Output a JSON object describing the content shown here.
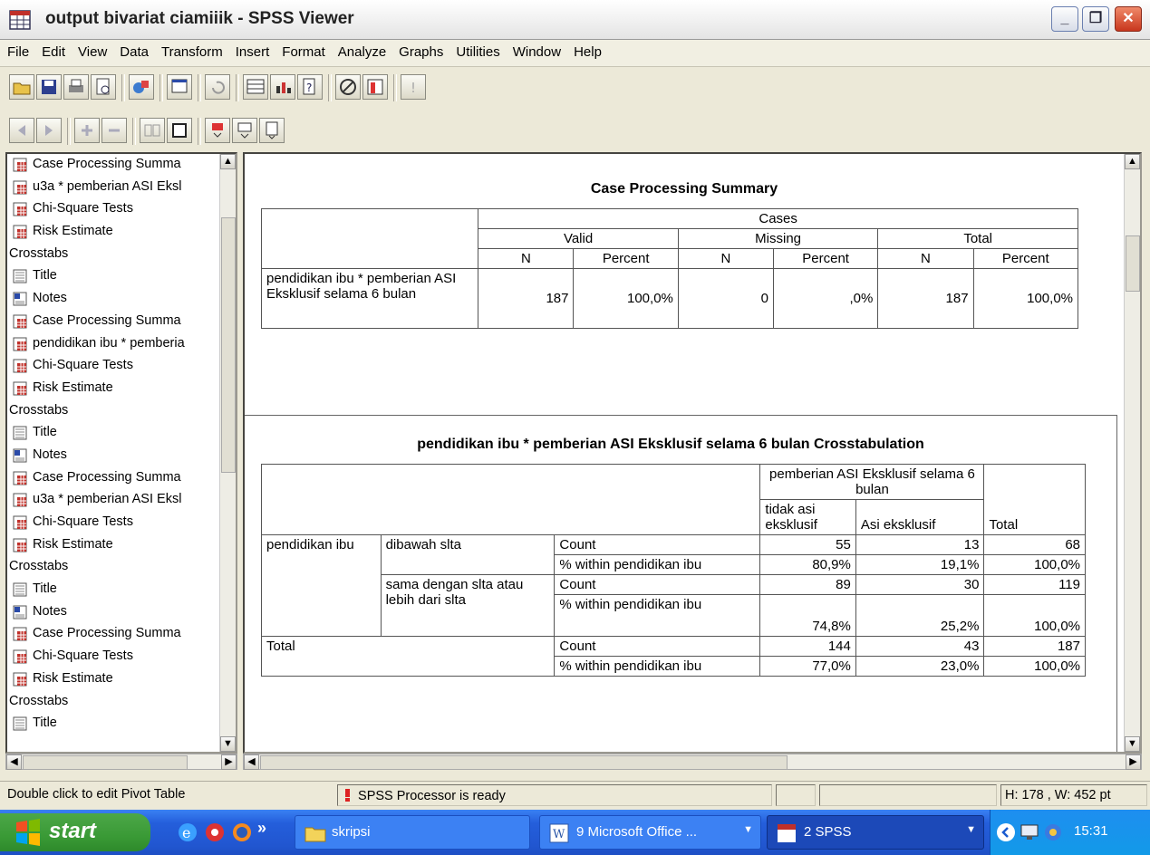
{
  "window": {
    "title": "output bivariat ciamiiik - SPSS Viewer",
    "min_label": "_",
    "max_label": "❐",
    "close_label": "✕"
  },
  "menu": [
    "File",
    "Edit",
    "View",
    "Data",
    "Transform",
    "Insert",
    "Format",
    "Analyze",
    "Graphs",
    "Utilities",
    "Window",
    "Help"
  ],
  "tree": [
    {
      "label": "Case Processing Summa",
      "icon": "table-icon",
      "hdr": false
    },
    {
      "label": "u3a * pemberian ASI Eksl",
      "icon": "table-icon",
      "hdr": false
    },
    {
      "label": "Chi-Square Tests",
      "icon": "table-icon",
      "hdr": false
    },
    {
      "label": "Risk Estimate",
      "icon": "table-icon",
      "hdr": false
    },
    {
      "label": "Crosstabs",
      "icon": "",
      "hdr": true
    },
    {
      "label": "Title",
      "icon": "title-icon",
      "hdr": false
    },
    {
      "label": "Notes",
      "icon": "notes-icon",
      "hdr": false
    },
    {
      "label": "Case Processing Summa",
      "icon": "table-icon",
      "hdr": false
    },
    {
      "label": "pendidikan ibu * pemberia",
      "icon": "table-icon",
      "hdr": false
    },
    {
      "label": "Chi-Square Tests",
      "icon": "table-icon",
      "hdr": false
    },
    {
      "label": "Risk Estimate",
      "icon": "table-icon",
      "hdr": false
    },
    {
      "label": "Crosstabs",
      "icon": "",
      "hdr": true
    },
    {
      "label": "Title",
      "icon": "title-icon",
      "hdr": false
    },
    {
      "label": "Notes",
      "icon": "notes-icon",
      "hdr": false
    },
    {
      "label": "Case Processing Summa",
      "icon": "table-icon",
      "hdr": false
    },
    {
      "label": "u3a * pemberian ASI Eksl",
      "icon": "table-icon",
      "hdr": false
    },
    {
      "label": "Chi-Square Tests",
      "icon": "table-icon",
      "hdr": false
    },
    {
      "label": "Risk Estimate",
      "icon": "table-icon",
      "hdr": false
    },
    {
      "label": "Crosstabs",
      "icon": "",
      "hdr": true
    },
    {
      "label": "Title",
      "icon": "title-icon",
      "hdr": false
    },
    {
      "label": "Notes",
      "icon": "notes-icon",
      "hdr": false
    },
    {
      "label": "Case Processing Summa",
      "icon": "table-icon",
      "hdr": false
    },
    {
      "label": "Chi-Square Tests",
      "icon": "table-icon",
      "hdr": false
    },
    {
      "label": "Risk Estimate",
      "icon": "table-icon",
      "hdr": false
    },
    {
      "label": "Crosstabs",
      "icon": "",
      "hdr": true
    },
    {
      "label": "Title",
      "icon": "title-icon",
      "hdr": false
    }
  ],
  "cps": {
    "title": "Case Processing Summary",
    "cases": "Cases",
    "valid": "Valid",
    "missing": "Missing",
    "total": "Total",
    "n": "N",
    "percent": "Percent",
    "row_label": "pendidikan ibu * pemberian ASI Eksklusif selama 6 bulan",
    "values": [
      "187",
      "100,0%",
      "0",
      ",0%",
      "187",
      "100,0%"
    ]
  },
  "xt": {
    "title": "pendidikan ibu * pemberian ASI Eksklusif selama 6 bulan Crosstabulation",
    "col_group": "pemberian ASI Eksklusif selama 6 bulan",
    "col1": "tidak asi eksklusif",
    "col2": "Asi eksklusif",
    "col_total": "Total",
    "var": "pendidikan ibu",
    "g1": "dibawah slta",
    "g2": "sama dengan slta atau lebih dari slta",
    "total": "Total",
    "count": "Count",
    "pct": "% within pendidikan ibu",
    "g1_count": [
      "55",
      "13",
      "68"
    ],
    "g1_pct": [
      "80,9%",
      "19,1%",
      "100,0%"
    ],
    "g2_count": [
      "89",
      "30",
      "119"
    ],
    "g2_pct": [
      "74,8%",
      "25,2%",
      "100,0%"
    ],
    "t_count": [
      "144",
      "43",
      "187"
    ],
    "t_pct": [
      "77,0%",
      "23,0%",
      "100,0%"
    ]
  },
  "status": {
    "hint": "Double click to edit Pivot Table",
    "processor": "SPSS Processor  is ready",
    "size": "H: 178 , W: 452 pt"
  },
  "taskbar": {
    "start": "start",
    "tasks": [
      "skripsi",
      "9 Microsoft Office ...",
      "2 SPSS"
    ],
    "chevron": "»",
    "time": "15:31"
  }
}
